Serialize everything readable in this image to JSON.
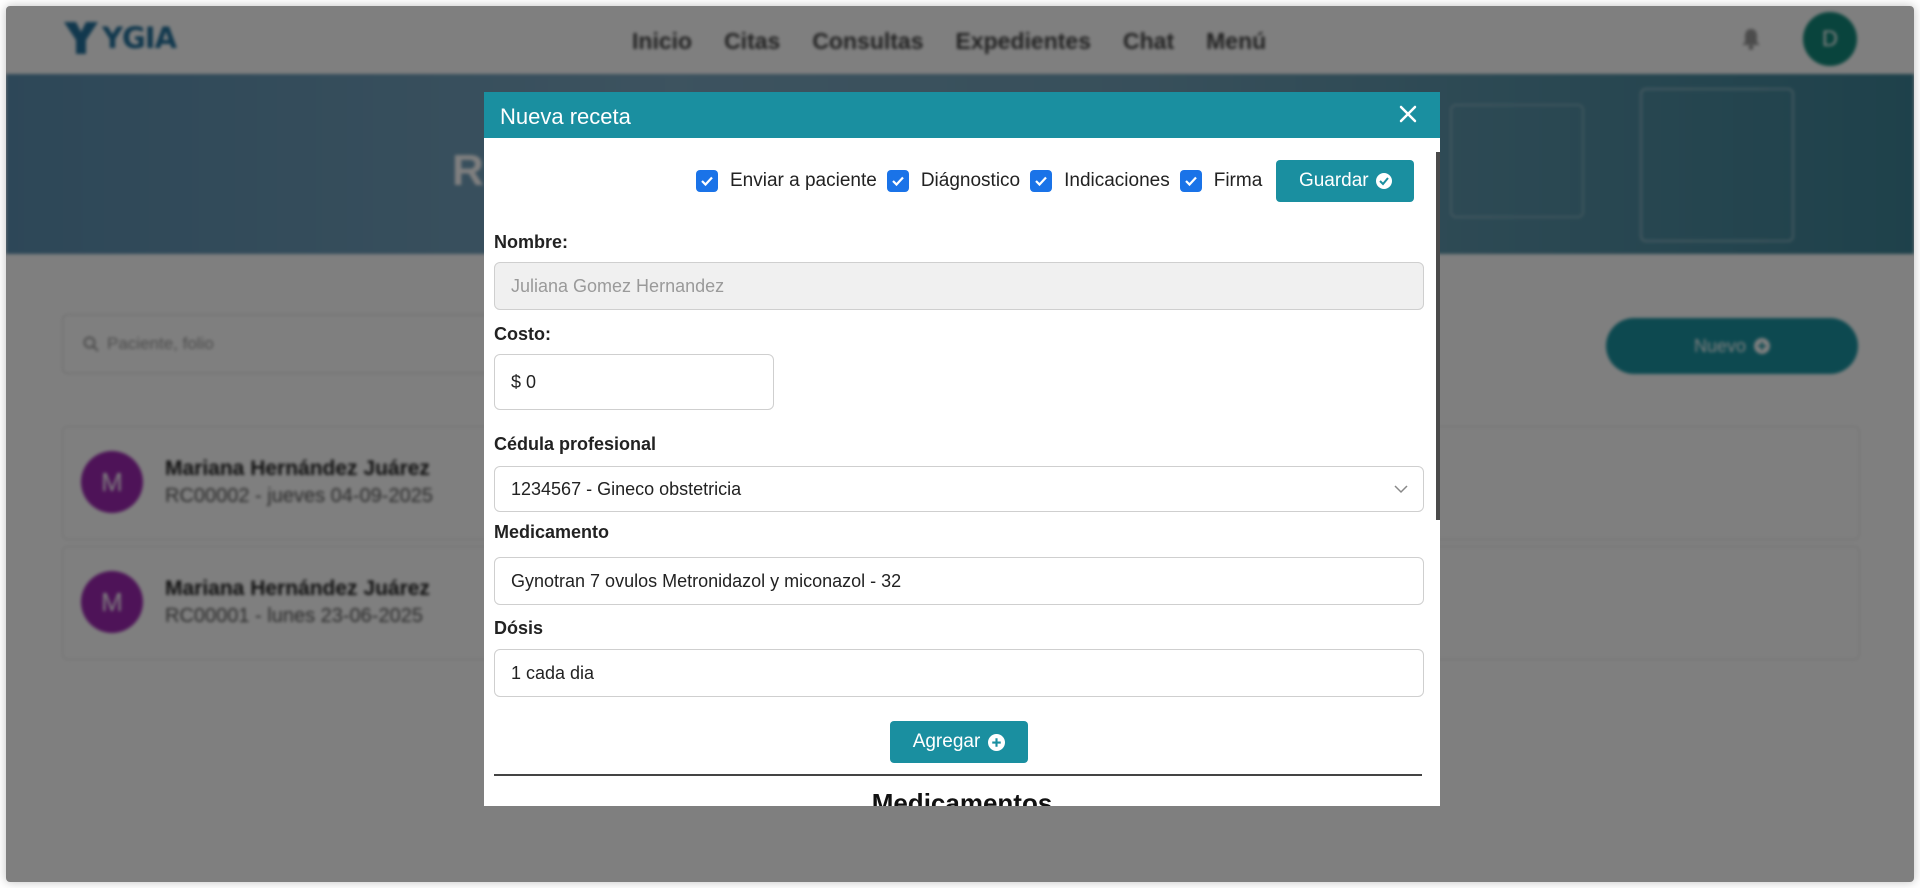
{
  "nav": {
    "logo_text": "YGIA",
    "links": [
      "Inicio",
      "Citas",
      "Consultas",
      "Expedientes",
      "Chat",
      "Menú"
    ],
    "avatar_initial": "D"
  },
  "hero": {
    "title": "R"
  },
  "search": {
    "placeholder": "Paciente, folio"
  },
  "new_button": {
    "label": "Nuevo"
  },
  "list": [
    {
      "initial": "M",
      "name": "Mariana Hernández Juárez",
      "detail": "RC00002 - jueves 04-09-2025"
    },
    {
      "initial": "M",
      "name": "Mariana Hernández Juárez",
      "detail": "RC00001 - lunes 23-06-2025"
    }
  ],
  "modal": {
    "title": "Nueva receta",
    "toolbar": {
      "checkboxes": [
        {
          "label": "Enviar a paciente",
          "checked": true
        },
        {
          "label": "Diágnostico",
          "checked": true
        },
        {
          "label": "Indicaciones",
          "checked": true
        },
        {
          "label": "Firma",
          "checked": true
        }
      ],
      "save_label": "Guardar"
    },
    "nombre": {
      "label": "Nombre:",
      "value": "Juliana Gomez Hernandez"
    },
    "costo": {
      "label": "Costo:",
      "value": "$ 0"
    },
    "cedula": {
      "label": "Cédula profesional",
      "value": "1234567 - Gineco obstetricia"
    },
    "medicamento": {
      "label": "Medicamento",
      "value": "Gynotran 7 ovulos Metronidazol y miconazol - 32"
    },
    "dosis": {
      "label": "Dósis",
      "value": "1 cada dia"
    },
    "add_label": "Agregar",
    "section_title": "Medicamentos"
  },
  "colors": {
    "primary": "#1a8fa0",
    "checkbox": "#1a73e8",
    "avatar_list": "#9c27b0",
    "avatar_user": "#13897b"
  }
}
